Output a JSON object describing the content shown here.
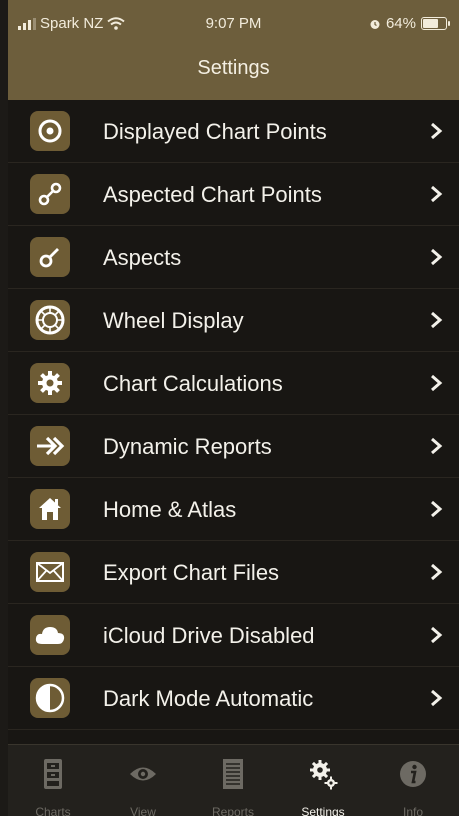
{
  "status_bar": {
    "carrier": "Spark NZ",
    "time": "9:07 PM",
    "battery": "64%",
    "battery_level": 0.64
  },
  "header": {
    "title": "Settings"
  },
  "settings_items": [
    {
      "label": "Displayed Chart Points",
      "icon": "target-icon"
    },
    {
      "label": "Aspected Chart Points",
      "icon": "linked-points-icon"
    },
    {
      "label": "Aspects",
      "icon": "aspect-icon"
    },
    {
      "label": "Wheel Display",
      "icon": "wheel-icon"
    },
    {
      "label": "Chart Calculations",
      "icon": "gear-icon"
    },
    {
      "label": "Dynamic Reports",
      "icon": "double-arrow-icon"
    },
    {
      "label": "Home & Atlas",
      "icon": "home-icon"
    },
    {
      "label": "Export Chart Files",
      "icon": "envelope-icon"
    },
    {
      "label": "iCloud Drive Disabled",
      "icon": "cloud-icon"
    },
    {
      "label": "Dark Mode Automatic",
      "icon": "half-circle-icon"
    }
  ],
  "tabs": [
    {
      "label": "Charts",
      "icon": "cabinet-icon",
      "active": false
    },
    {
      "label": "View",
      "icon": "eye-icon",
      "active": false
    },
    {
      "label": "Reports",
      "icon": "document-icon",
      "active": false
    },
    {
      "label": "Settings",
      "icon": "gears-icon",
      "active": true
    },
    {
      "label": "Info",
      "icon": "info-icon",
      "active": false
    }
  ],
  "colors": {
    "header_bg": "#6d5e3c",
    "icon_tile": "#6e5c35",
    "list_bg": "#181613",
    "tab_inactive": "#6d6a63",
    "tab_active": "#f3f1ea"
  }
}
